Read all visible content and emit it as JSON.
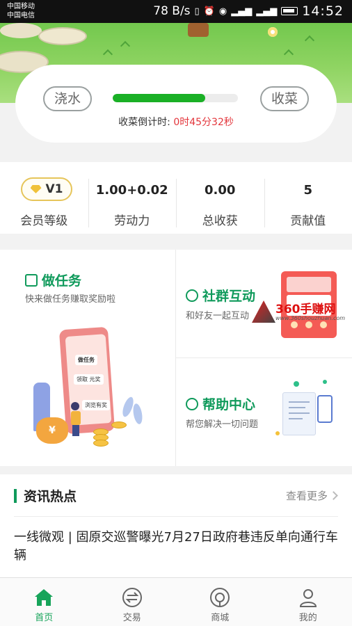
{
  "status_bar": {
    "carrier_1": "中国移动",
    "carrier_2": "中国电信",
    "speed": "78 B/s",
    "time": "14:52"
  },
  "farm": {
    "water_button": "浇水",
    "harvest_button": "收菜",
    "progress": 0.74,
    "countdown_label": "收菜倒计时:",
    "countdown_value": "0时45分32秒",
    "accent_color": "#1ab026",
    "countdown_color": "#e3353b"
  },
  "stats": {
    "vip_level": "V1",
    "vip_label": "会员等级",
    "labor_value": "1.00+0.02",
    "labor_label": "劳动力",
    "harvest_value": "0.00",
    "harvest_label": "总收获",
    "contribution_value": "5",
    "contribution_label": "贡献值"
  },
  "features": {
    "tasks_title": "做任务",
    "tasks_sub": "快来做任务赚取奖励啦",
    "community_title": "社群互动",
    "community_sub": "和好友一起互动",
    "help_title": "帮助中心",
    "help_sub": "帮您解决一切问题",
    "illus_task_label": "做任务",
    "illus_card_1": "领取 元奖",
    "illus_card_2": "浏览有奖",
    "illus_sack": "¥",
    "title_color": "#0f9a5b"
  },
  "watermark": {
    "brand": "360手赚网",
    "url": "www.360shouzhuan.com"
  },
  "news": {
    "title": "资讯热点",
    "more": "查看更多",
    "headline": "一线微观 | 固原交巡警曝光7月27日政府巷违反单向通行车辆"
  },
  "bottom_nav": {
    "items": [
      {
        "label": "首页",
        "icon": "home-icon",
        "active": true
      },
      {
        "label": "交易",
        "icon": "exchange-icon",
        "active": false
      },
      {
        "label": "商城",
        "icon": "shop-icon",
        "active": false
      },
      {
        "label": "我的",
        "icon": "user-icon",
        "active": false
      }
    ],
    "active_color": "#17a45a"
  }
}
